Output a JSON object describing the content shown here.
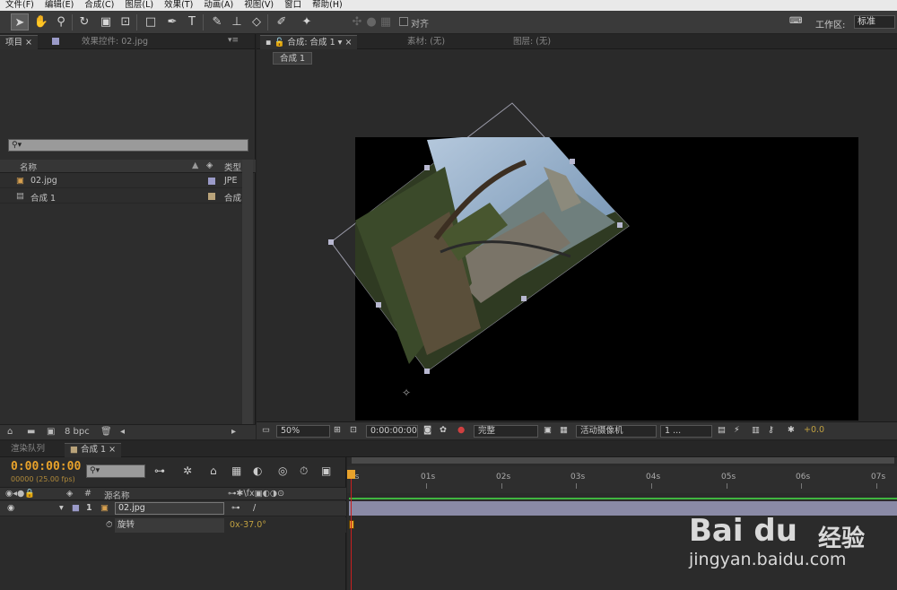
{
  "menu": [
    "文件(F)",
    "编辑(E)",
    "合成(C)",
    "图层(L)",
    "效果(T)",
    "动画(A)",
    "视图(V)",
    "窗口",
    "帮助(H)"
  ],
  "toolbar": {
    "align_label": "对齐",
    "workspace_label": "工作区:",
    "workspace_value": "标准"
  },
  "project_panel": {
    "tab_project": "项目",
    "tab_effects": "效果控件: 02.jpg",
    "search_placeholder": "⚲▾",
    "col_name": "名称",
    "col_type": "类型",
    "items": [
      {
        "name": "02.jpg",
        "type": "JPE",
        "label_color": "#9a9ac8"
      },
      {
        "name": "合成 1",
        "type": "合成",
        "label_color": "#b9a37a"
      }
    ],
    "bpc": "8 bpc"
  },
  "comp_panel": {
    "tab_comp": "合成: 合成 1",
    "tab_footage": "素材: (无)",
    "tab_layer": "图层: (无)",
    "breadcrumb": "合成 1",
    "footer": {
      "zoom": "50%",
      "timecode": "0:00:00:00",
      "resolution": "完整",
      "camera": "活动摄像机",
      "views": "1 ...",
      "exposure": "+0.0"
    }
  },
  "timeline": {
    "tab_render": "渲染队列",
    "tab_comp": "合成 1",
    "timecode": "0:00:00:00",
    "fps": "00000 (25.00 fps)",
    "search_placeholder": "⚲▾",
    "col_hash": "#",
    "col_source": "源名称",
    "layer": {
      "index": "1",
      "name": "02.jpg"
    },
    "property": {
      "name": "旋转",
      "value": "0x-37.0°"
    },
    "ruler_labels": [
      "0s",
      "01s",
      "02s",
      "03s",
      "04s",
      "05s",
      "06s",
      "07s"
    ],
    "colors": {
      "timecode": "#e8a22b",
      "green_track": "#3fb53f",
      "layer_bar": "#8a8aa6",
      "playhead": "#c82020"
    }
  },
  "watermark": {
    "logo": "Bai du",
    "logo_cn": "经验",
    "url": "jingyan.baidu.com"
  }
}
